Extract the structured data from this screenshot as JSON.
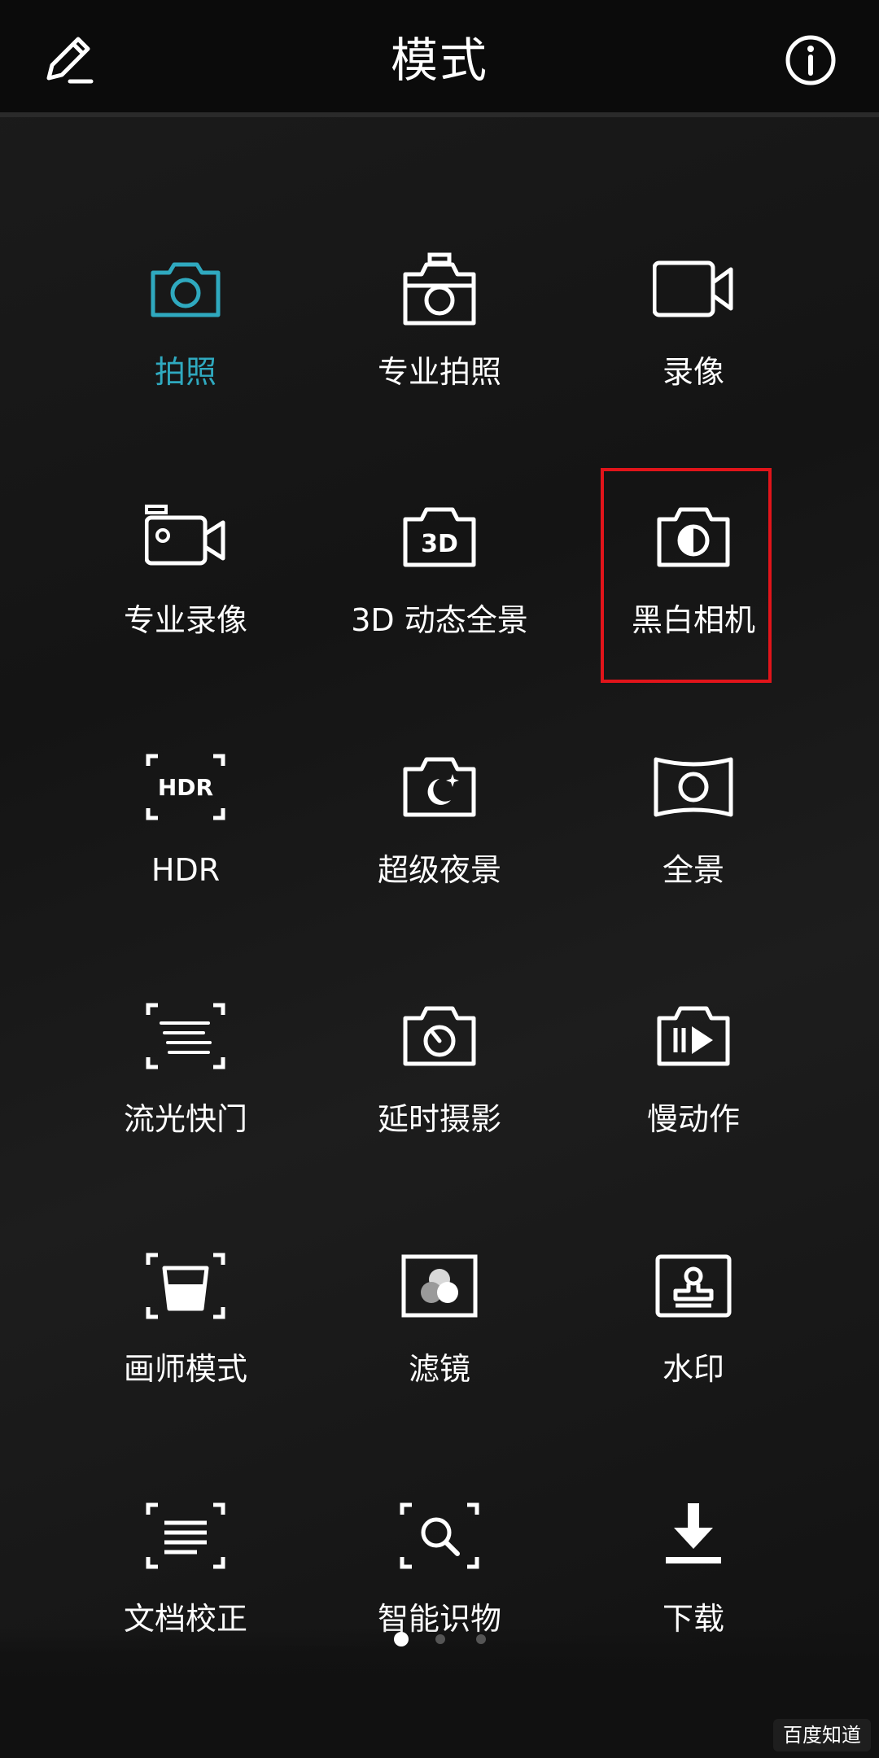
{
  "header": {
    "title": "模式",
    "edit_icon": "pencil-icon",
    "info_icon": "info-icon"
  },
  "modes": [
    {
      "label": "拍照",
      "icon": "camera-icon",
      "active": true
    },
    {
      "label": "专业拍照",
      "icon": "pro-camera-icon",
      "active": false
    },
    {
      "label": "录像",
      "icon": "video-icon",
      "active": false
    },
    {
      "label": "专业录像",
      "icon": "pro-video-icon",
      "active": false
    },
    {
      "label": "3D 动态全景",
      "icon": "3d-camera-icon",
      "active": false
    },
    {
      "label": "黑白相机",
      "icon": "monochrome-camera-icon",
      "active": false
    },
    {
      "label": "HDR",
      "icon": "hdr-icon",
      "active": false
    },
    {
      "label": "超级夜景",
      "icon": "night-mode-icon",
      "active": false
    },
    {
      "label": "全景",
      "icon": "panorama-icon",
      "active": false
    },
    {
      "label": "流光快门",
      "icon": "light-painting-icon",
      "active": false
    },
    {
      "label": "延时摄影",
      "icon": "time-lapse-icon",
      "active": false
    },
    {
      "label": "慢动作",
      "icon": "slow-motion-icon",
      "active": false
    },
    {
      "label": "画师模式",
      "icon": "artist-mode-icon",
      "active": false
    },
    {
      "label": "滤镜",
      "icon": "filter-icon",
      "active": false
    },
    {
      "label": "水印",
      "icon": "watermark-icon",
      "active": false
    },
    {
      "label": "文档校正",
      "icon": "document-scan-icon",
      "active": false
    },
    {
      "label": "智能识物",
      "icon": "object-recognition-icon",
      "active": false
    },
    {
      "label": "下载",
      "icon": "download-icon",
      "active": false
    }
  ],
  "highlighted_mode": "黑白相机",
  "pagination": {
    "pages": 3,
    "current": 1
  },
  "colors": {
    "accent": "#2fa9bf",
    "highlight_border": "#e1141a",
    "background": "#151515"
  },
  "watermark_text": "百度知道"
}
